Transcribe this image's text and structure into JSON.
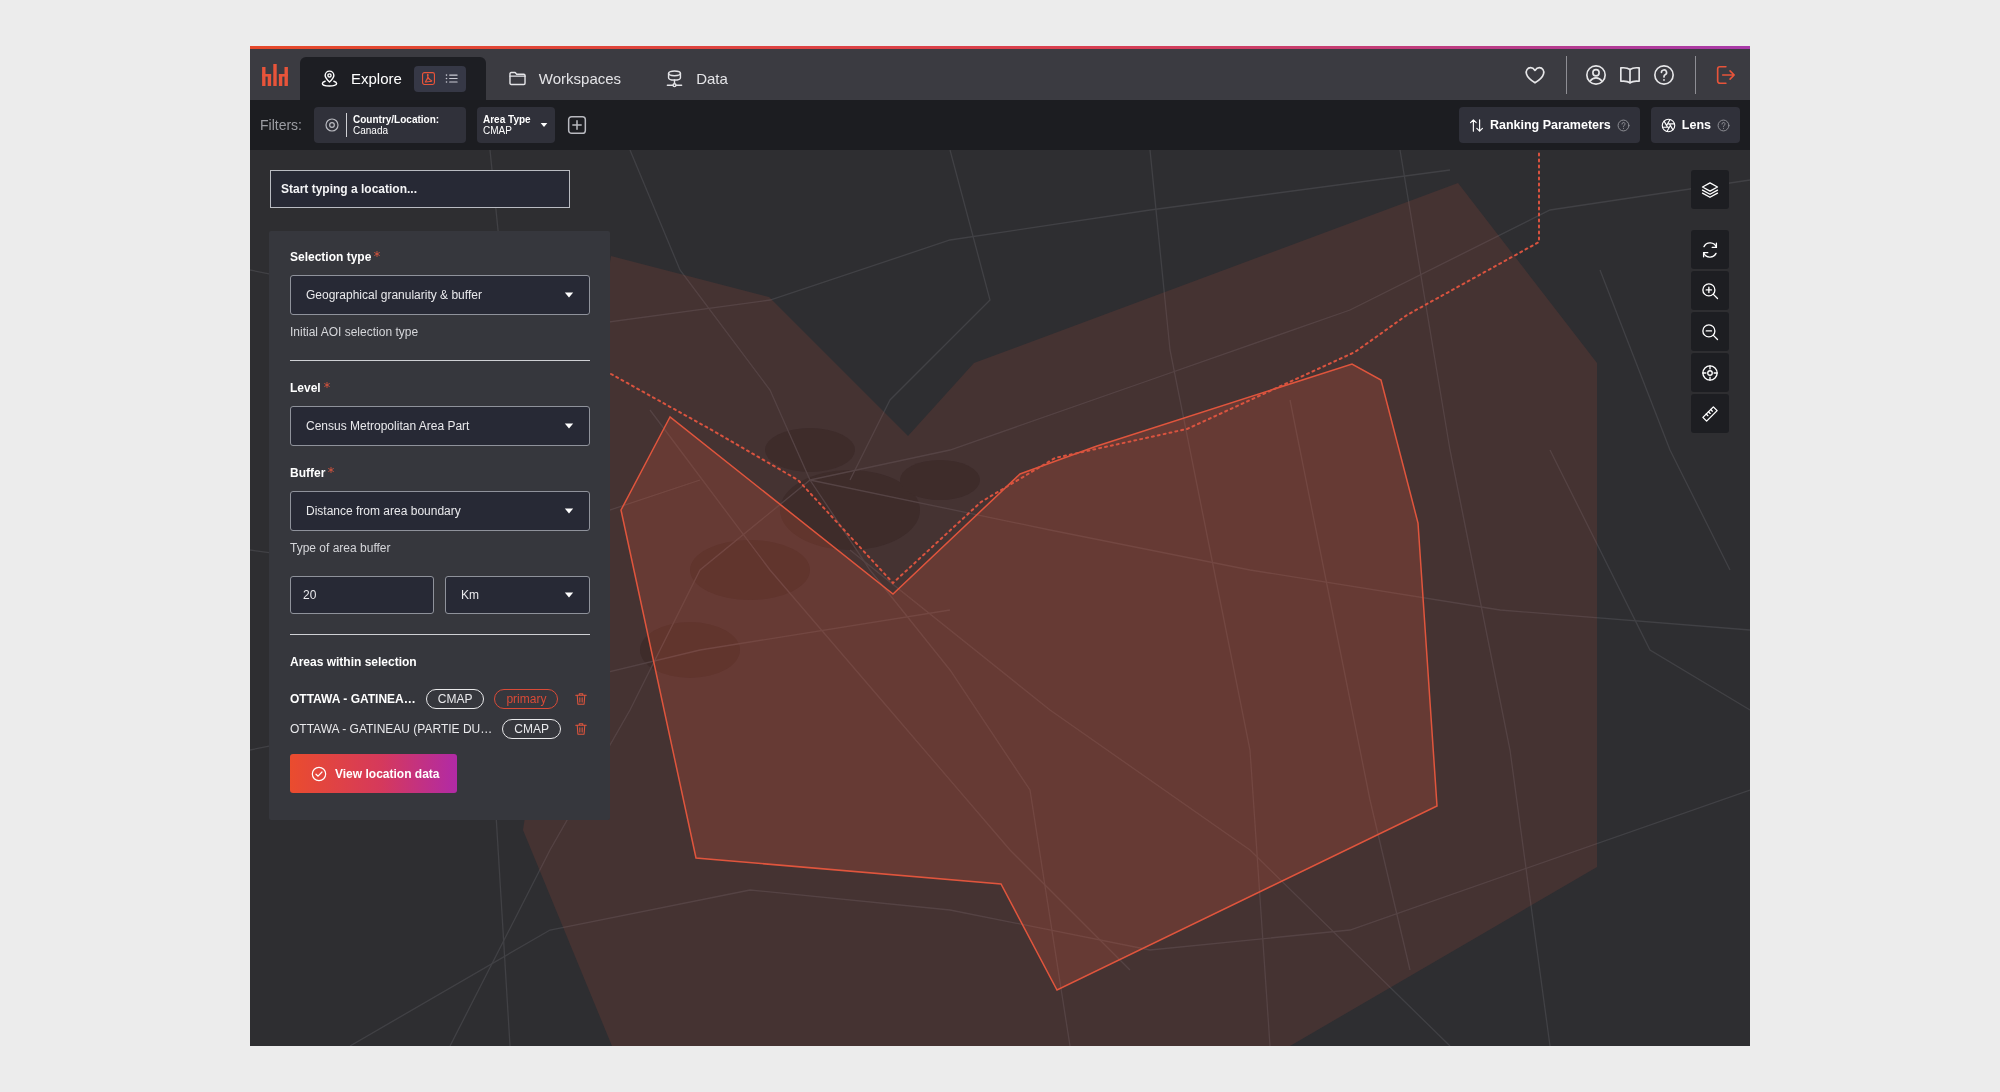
{
  "nav": {
    "tabs": [
      {
        "label": "Explore",
        "selected": true
      },
      {
        "label": "Workspaces",
        "selected": false
      },
      {
        "label": "Data",
        "selected": false
      }
    ]
  },
  "filters": {
    "label": "Filters:",
    "items": [
      {
        "kind": "location",
        "title": "Country/Location:",
        "value": "Canada"
      },
      {
        "kind": "dropdown",
        "title": "Area Type",
        "value": "CMAP"
      }
    ],
    "actions": [
      {
        "label": "Ranking Parameters"
      },
      {
        "label": "Lens"
      }
    ]
  },
  "search": {
    "placeholder": "Start typing a location..."
  },
  "selection_panel": {
    "sections": [
      {
        "fields": [
          {
            "kind": "select",
            "label": "Selection type",
            "required": true,
            "value": "Geographical granularity & buffer",
            "hint": "Initial AOI selection type"
          }
        ]
      },
      {
        "fields": [
          {
            "kind": "select",
            "label": "Level",
            "required": true,
            "value": "Census Metropolitan Area Part"
          },
          {
            "kind": "select",
            "label": "Buffer",
            "required": true,
            "value": "Distance from area boundary",
            "hint": "Type of area buffer"
          },
          {
            "kind": "distance",
            "value": "20",
            "unit": "Km"
          }
        ]
      }
    ],
    "areas": {
      "title": "Areas within selection",
      "items": [
        {
          "name": "OTTAWA - GATINEA…",
          "type": "CMAP",
          "primary": true,
          "badge": "primary"
        },
        {
          "name": "OTTAWA - GATINEAU (PARTIE DU…",
          "type": "CMAP",
          "primary": false
        }
      ]
    },
    "submit": {
      "label": "View location data"
    }
  }
}
